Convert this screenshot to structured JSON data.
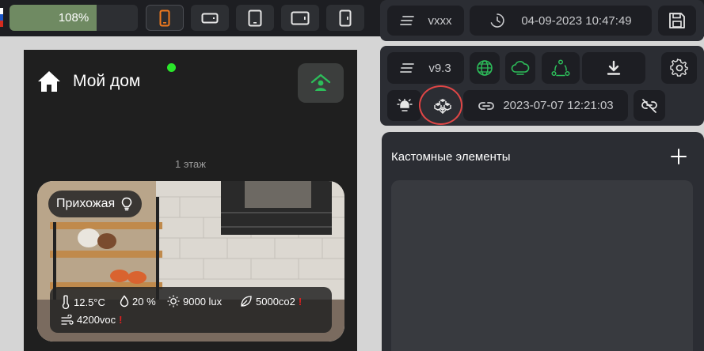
{
  "toolbar": {
    "zoom_percent": 108,
    "zoom_label": "108%",
    "device_icons": [
      "mobile-icon",
      "small-tablet-landscape-icon",
      "tablet-icon",
      "tablet-landscape-icon",
      "tablet-portrait-icon"
    ]
  },
  "header": {
    "project_label": "vxxx",
    "timestamp": "04-09-2023 10:47:49"
  },
  "info": {
    "version": "v9.3",
    "link_timestamp": "2023-07-07 12:21:03"
  },
  "preview": {
    "title": "Мой дом",
    "floor_label": "1 этаж",
    "room": {
      "name": "Прихожая",
      "temperature": "12.5°C",
      "humidity": "20 %",
      "light": "9000 lux",
      "co2": "5000co2",
      "voc": "4200voc",
      "warning_mark": "!"
    }
  },
  "custom": {
    "title": "Кастомные элементы"
  },
  "colors": {
    "accent_green": "#2dbd5a",
    "highlight_ring": "#e04646",
    "status_online": "#2ae62a",
    "warning": "#e02020"
  }
}
